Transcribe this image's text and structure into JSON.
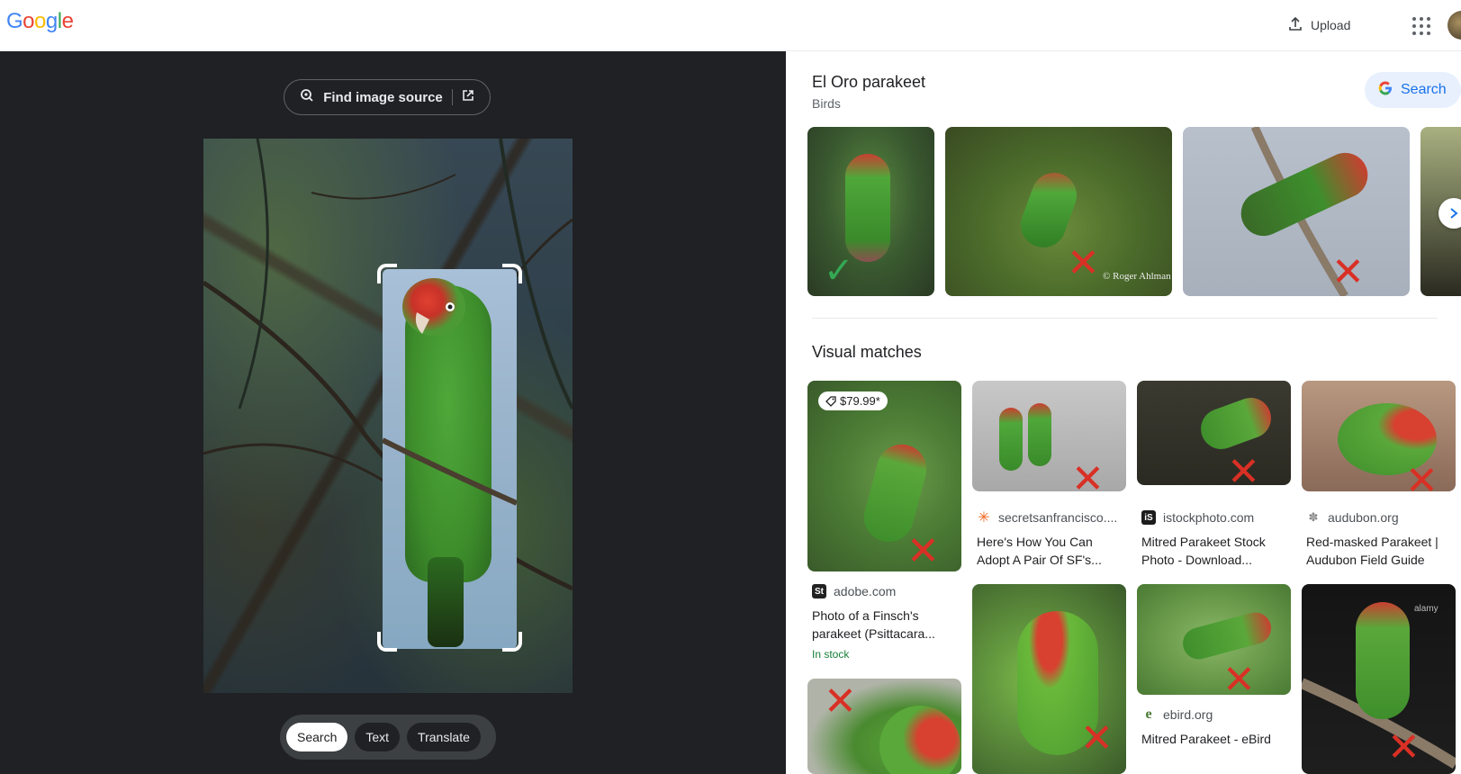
{
  "header": {
    "logo_letters": [
      "G",
      "o",
      "o",
      "g",
      "l",
      "e"
    ],
    "logo_colors": [
      "#4285f4",
      "#ea4335",
      "#fbbc05",
      "#4285f4",
      "#34a853",
      "#ea4335"
    ],
    "upload_label": "Upload",
    "upload_icon": "upload-icon",
    "apps_icon": "apps-grid-icon"
  },
  "lens": {
    "find_source_label": "Find image source",
    "modes": [
      {
        "label": "Search",
        "active": true
      },
      {
        "label": "Text",
        "active": false
      },
      {
        "label": "Translate",
        "active": false
      }
    ]
  },
  "entity": {
    "title": "El Oro parakeet",
    "subtitle": "Birds",
    "search_label": "Search"
  },
  "visual_matches": {
    "title": "Visual matches",
    "items": [
      {
        "price": "$79.99*",
        "source": "adobe.com",
        "title": "Photo of a Finsch's parakeet (Psittacara...",
        "stock": "In stock"
      },
      {
        "source": "secretsanfrancisco....",
        "title": "Here's How You Can Adopt A Pair Of SF's..."
      },
      {
        "source": "istockphoto.com",
        "title": "Mitred Parakeet Stock Photo - Download..."
      },
      {
        "source": "audubon.org",
        "title": "Red-masked Parakeet | Audubon Field Guide"
      },
      {
        "source": "ebird.org",
        "title": "Mitred Parakeet - eBird"
      }
    ]
  },
  "watermark": "© Roger Ahlman",
  "alamy": "alamy",
  "colors": {
    "accent": "#1a73e8",
    "dark_bg": "#202124",
    "mark_red": "#d93025",
    "mark_green": "#34a853"
  }
}
